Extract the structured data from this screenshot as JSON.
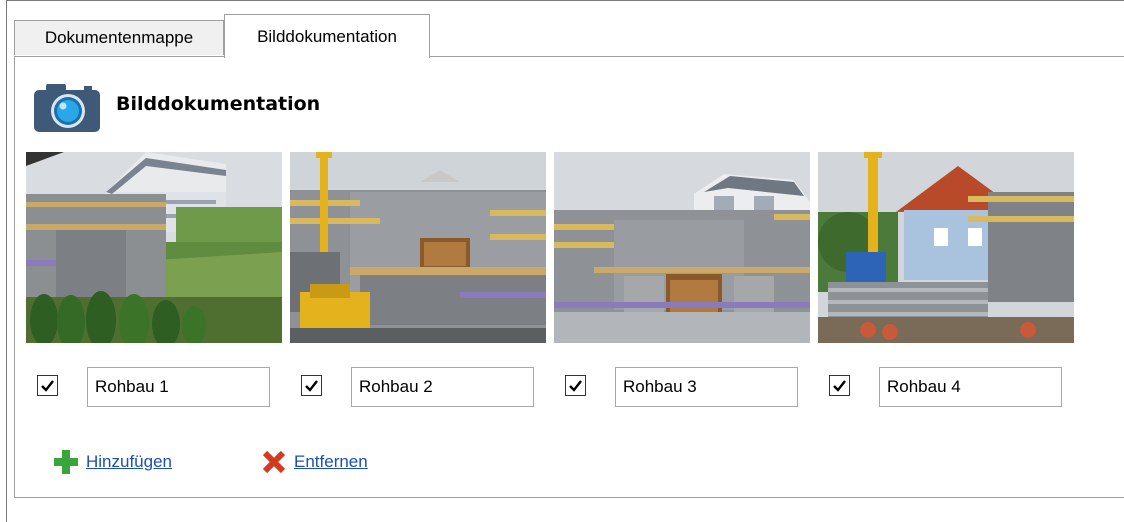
{
  "tabs": [
    {
      "label": "Dokumentenmappe",
      "active": false
    },
    {
      "label": "Bilddokumentation",
      "active": true
    }
  ],
  "section": {
    "title": "Bilddokumentation",
    "icon": "camera-icon"
  },
  "photos": [
    {
      "caption": "Rohbau 1",
      "checked": true
    },
    {
      "caption": "Rohbau 2",
      "checked": true
    },
    {
      "caption": "Rohbau 3",
      "checked": true
    },
    {
      "caption": "Rohbau 4",
      "checked": true
    }
  ],
  "actions": {
    "add": {
      "label": "Hinzufügen",
      "icon": "plus-icon",
      "color": "#3aa53a"
    },
    "remove": {
      "label": "Entfernen",
      "icon": "cross-icon",
      "color": "#d33a1f"
    }
  },
  "colors": {
    "link": "#1a50b8",
    "camera_body": "#3f5a78",
    "camera_lens": "#2aa7e6"
  }
}
